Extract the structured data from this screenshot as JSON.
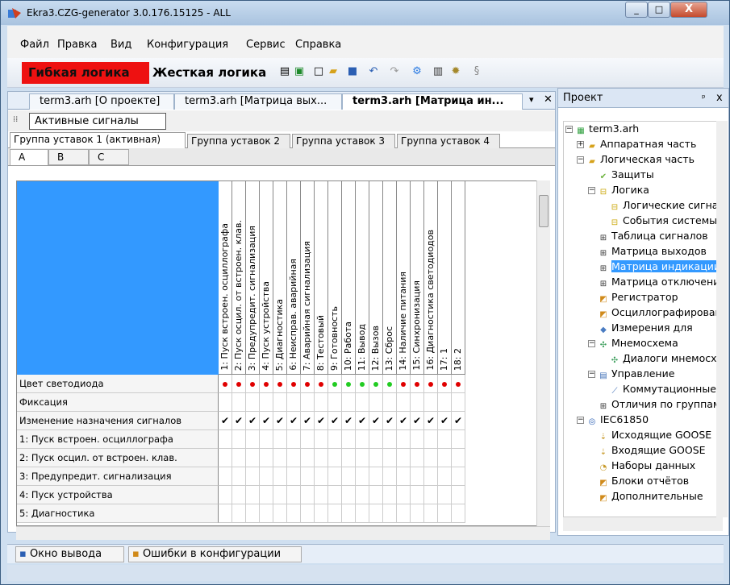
{
  "window": {
    "title": "Ekra3.CZG-generator 3.0.176.15125 - ALL",
    "min": "_",
    "max": "□",
    "close": "X"
  },
  "menu": [
    "Файл",
    "Правка",
    "Вид",
    "Конфигурация",
    "Сервис",
    "Справка"
  ],
  "toolbar": {
    "flex_logic": "Гибкая логика",
    "hard_logic": "Жесткая логика"
  },
  "doc_tabs": [
    "term3.arh [О проекте]",
    "term3.arh [Матрица вых...",
    "term3.arh [Матрица ин..."
  ],
  "doc_tabs_menu": "▾",
  "doc_tabs_close": "✕",
  "active_signals_label": "Активные сигналы",
  "group_tabs": [
    "Группа уставок 1 (активная)",
    "Группа уставок 2",
    "Группа уставок 3",
    "Группа уставок 4"
  ],
  "phase_tabs": [
    "A",
    "B",
    "C"
  ],
  "columns": [
    "1: Пуск встроен. осциллографа",
    "2: Пуск осцил. от встроен. клав.",
    "3: Предупредит. сигнализация",
    "4: Пуск устройства",
    "5: Диагностика",
    "6: Неисправ. аварийная",
    "7: Аварийная сигнализация",
    "8: Тестовый",
    "9: Готовность",
    "10: Работа",
    "11: Вывод",
    "12: Вызов",
    "13: Сброс",
    "14: Наличие питания",
    "15: Синхронизация",
    "16: Диагностика светодиодов",
    "17: 1",
    "18: 2"
  ],
  "led_colors": [
    "red",
    "red",
    "red",
    "red",
    "red",
    "red",
    "red",
    "red",
    "green",
    "green",
    "green",
    "green",
    "green",
    "red",
    "red",
    "red",
    "red",
    "red"
  ],
  "colors": {
    "red": "#e00000",
    "green": "#22cc22",
    "accent": "#3399ff"
  },
  "rows": [
    {
      "label": "Цвет светодиода",
      "type": "color"
    },
    {
      "label": "Фиксация",
      "type": "empty"
    },
    {
      "label": "Изменение назначения сигналов",
      "type": "check"
    },
    {
      "label": "1: Пуск встроен. осциллографа",
      "type": "empty"
    },
    {
      "label": "2: Пуск осцил. от встроен. клав.",
      "type": "empty"
    },
    {
      "label": "3: Предупредит. сигнализация",
      "type": "empty"
    },
    {
      "label": "4: Пуск устройства",
      "type": "empty"
    },
    {
      "label": "5: Диагностика",
      "type": "empty"
    }
  ],
  "check_mark": "✔",
  "project": {
    "title": "Проект",
    "pin": "ᵖ",
    "close": "x",
    "tree": [
      {
        "label": "term3.arh",
        "level": 0,
        "icon": "project-icon",
        "exp": "−"
      },
      {
        "label": "Аппаратная часть",
        "level": 1,
        "icon": "folder-icon",
        "exp": "+"
      },
      {
        "label": "Логическая часть",
        "level": 1,
        "icon": "folder-icon",
        "exp": "−"
      },
      {
        "label": "Защиты",
        "level": 2,
        "icon": "protection-icon"
      },
      {
        "label": "Логика",
        "level": 2,
        "icon": "logic-icon",
        "exp": "−"
      },
      {
        "label": "Логические сигналы",
        "level": 3,
        "icon": "logic-icon"
      },
      {
        "label": "События системы",
        "level": 3,
        "icon": "logic-icon"
      },
      {
        "label": "Таблица сигналов",
        "level": 2,
        "icon": "table-icon"
      },
      {
        "label": "Матрица выходов",
        "level": 2,
        "icon": "table-icon"
      },
      {
        "label": "Матрица индикации",
        "level": 2,
        "icon": "table-icon",
        "selected": true
      },
      {
        "label": "Матрица отключений",
        "level": 2,
        "icon": "table-icon"
      },
      {
        "label": "Регистратор",
        "level": 2,
        "icon": "recorder-icon"
      },
      {
        "label": "Осциллографирование",
        "level": 2,
        "icon": "recorder-icon"
      },
      {
        "label": "Измерения для",
        "level": 2,
        "icon": "measure-icon"
      },
      {
        "label": "Мнемосхема",
        "level": 2,
        "icon": "mnemo-icon",
        "exp": "−"
      },
      {
        "label": "Диалоги мнемосхемы",
        "level": 3,
        "icon": "mnemo-icon"
      },
      {
        "label": "Управление",
        "level": 2,
        "icon": "control-icon",
        "exp": "−"
      },
      {
        "label": "Коммутационные",
        "level": 3,
        "icon": "switch-icon"
      },
      {
        "label": "Отличия по группам",
        "level": 2,
        "icon": "table-icon"
      },
      {
        "label": "IEC61850",
        "level": 1,
        "icon": "iec-icon",
        "exp": "−"
      },
      {
        "label": "Исходящие GOOSE",
        "level": 2,
        "icon": "goose-icon"
      },
      {
        "label": "Входящие GOOSE",
        "level": 2,
        "icon": "goose-icon"
      },
      {
        "label": "Наборы данных",
        "level": 2,
        "icon": "dataset-icon"
      },
      {
        "label": "Блоки отчётов",
        "level": 2,
        "icon": "report-icon"
      },
      {
        "label": "Дополнительные",
        "level": 2,
        "icon": "report-icon"
      }
    ]
  },
  "bottom_tabs": [
    "Окно вывода",
    "Ошибки в конфигурации"
  ]
}
